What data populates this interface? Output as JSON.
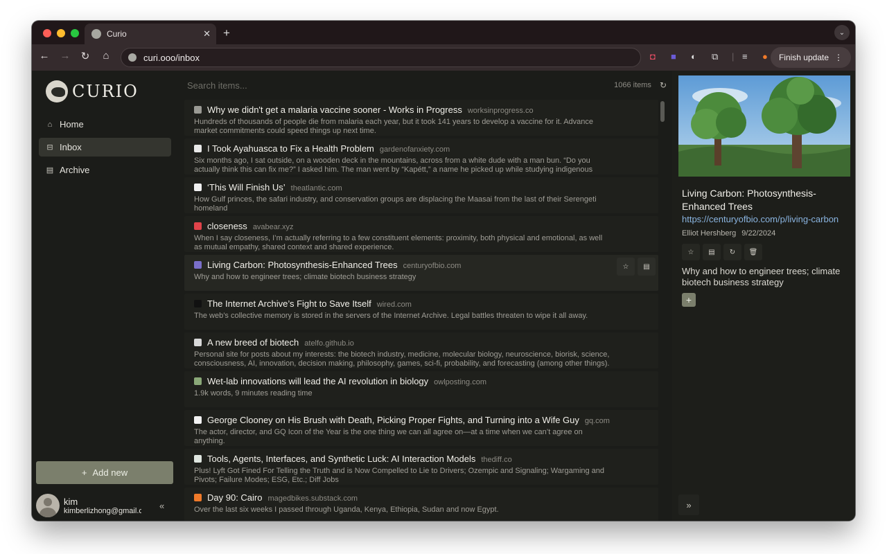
{
  "browser": {
    "tab_title": "Curio",
    "tab_close": "✕",
    "new_tab": "+",
    "url": "curi.ooo/inbox",
    "finish_update": "Finish update"
  },
  "sidebar": {
    "logo_text": "CURIO",
    "nav": [
      {
        "label": "Home",
        "icon": "home-icon"
      },
      {
        "label": "Inbox",
        "icon": "inbox-icon",
        "active": true
      },
      {
        "label": "Archive",
        "icon": "archive-icon"
      }
    ],
    "add_new": "Add new",
    "user_name": "kim",
    "user_email": "kimberlizhong@gmail.com"
  },
  "main": {
    "search_placeholder": "Search items...",
    "count": "1066 items",
    "items": [
      {
        "title": "Why we didn't get a malaria vaccine sooner - Works in Progress",
        "domain": "worksinprogress.co",
        "desc": "Hundreds of thousands of people die from malaria each year, but it took 141 years to develop a vaccine for it. Advance market commitments could speed things up next time.",
        "fav_color": "#9a9a94"
      },
      {
        "title": "I Took Ayahuasca to Fix a Health Problem",
        "domain": "gardenofanxiety.com",
        "desc": "Six months ago, I sat outside, on a wooden deck in the mountains, across from a white dude with a man bun. “Do you actually think this can fix me?” I asked him. The man went by “Kapétt,” a name he picked up while studying indigenous culture in a",
        "fav_color": "#e8e8e8"
      },
      {
        "title": "‘This Will Finish Us’",
        "domain": "theatlantic.com",
        "desc": "How Gulf princes, the safari industry, and conservation groups are displacing the Maasai from the last of their Serengeti homeland",
        "fav_color": "#f0f0f0"
      },
      {
        "title": "closeness",
        "domain": "avabear.xyz",
        "desc": "When I say closeness, I’m actually referring to a few constituent elements: proximity, both physical and emotional, as well as mutual empathy, shared context and shared experience.",
        "fav_color": "#e0434a"
      },
      {
        "title": "Living Carbon: Photosynthesis-Enhanced Trees",
        "domain": "centuryofbio.com",
        "desc": "Why and how to engineer trees; climate biotech business strategy",
        "fav_color": "#7a6fc9",
        "selected": true
      },
      {
        "title": "The Internet Archive’s Fight to Save Itself",
        "domain": "wired.com",
        "desc": "The web’s collective memory is stored in the servers of the Internet Archive. Legal battles threaten to wipe it all away.",
        "fav_color": "#111111"
      },
      {
        "title": "A new breed of biotech",
        "domain": "atelfo.github.io",
        "desc": "Personal site for posts about my interests: the biotech industry, medicine, molecular biology, neuroscience, biorisk, science, consciousness, AI, innovation, decision making, philosophy, games, sci-fi, probability, and forecasting (among other things). I",
        "fav_color": "#d8d8d8"
      },
      {
        "title": "Wet-lab innovations will lead the AI revolution in biology",
        "domain": "owlposting.com",
        "desc": "1.9k words, 9 minutes reading time",
        "fav_color": "#8aa878"
      },
      {
        "title": "George Clooney on His Brush with Death, Picking Proper Fights, and Turning into a Wife Guy",
        "domain": "gq.com",
        "desc": "The actor, director, and GQ Icon of the Year is the one thing we can all agree on—at a time when we can’t agree on anything.",
        "fav_color": "#f2f2f2"
      },
      {
        "title": "Tools, Agents, Interfaces, and Synthetic Luck: AI Interaction Models",
        "domain": "thediff.co",
        "desc": "Plus! Lyft Got Fined For Telling the Truth and is Now Compelled to Lie to Drivers; Ozempic and Signaling; Wargaming and Pivots; Failure Modes; ESG, Etc.; Diff Jobs",
        "fav_color": "#dfe6e0"
      },
      {
        "title": "Day 90: Cairo",
        "domain": "magedbikes.substack.com",
        "desc": "Over the last six weeks I passed through Uganda, Kenya, Ethiopia, Sudan and now Egypt.",
        "fav_color": "#f07a2a"
      }
    ]
  },
  "panel": {
    "title": "Living Carbon: Photosynthesis-Enhanced Trees",
    "link": "https://centuryofbio.com/p/living-carbon",
    "author": "Elliot Hershberg",
    "date": "9/22/2024",
    "desc": "Why and how to engineer trees; climate biotech business strategy",
    "tag_add": "+"
  }
}
